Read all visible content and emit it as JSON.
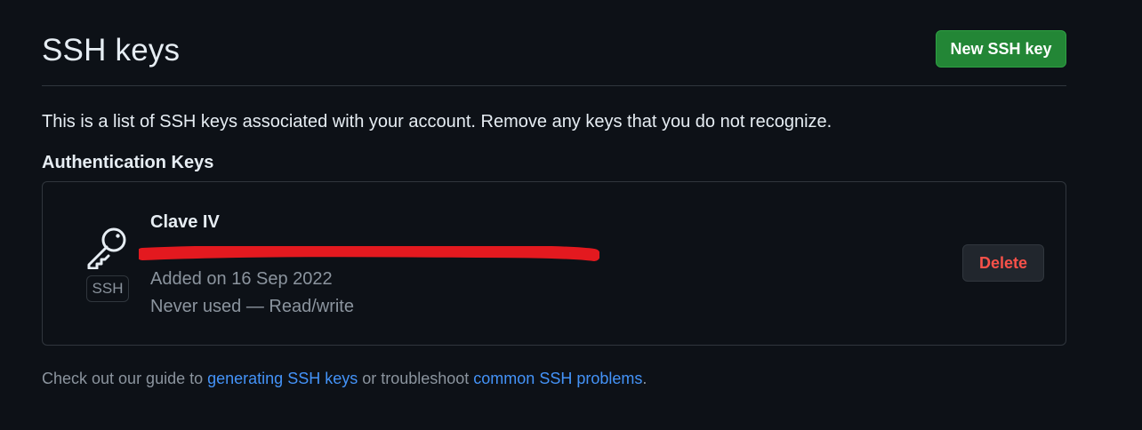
{
  "header": {
    "title": "SSH keys",
    "new_key_button": "New SSH key"
  },
  "intro": "This is a list of SSH keys associated with your account. Remove any keys that you do not recognize.",
  "section_title": "Authentication Keys",
  "keys": [
    {
      "icon": "key-icon",
      "type_label": "SSH",
      "name": "Clave IV",
      "fingerprint_redacted": true,
      "added": "Added on 16 Sep 2022",
      "usage": "Never used — Read/write",
      "delete_label": "Delete"
    }
  ],
  "footer": {
    "text_before": "Check out our guide to ",
    "link_generating": "generating SSH keys",
    "text_middle": " or troubleshoot ",
    "link_problems": "common SSH problems",
    "text_after": "."
  },
  "colors": {
    "background": "#0d1117",
    "border": "#30363d",
    "primary_button": "#238636",
    "danger_text": "#f85149",
    "link": "#4493f8",
    "muted_text": "#8b949e",
    "redaction": "#e3191f"
  }
}
